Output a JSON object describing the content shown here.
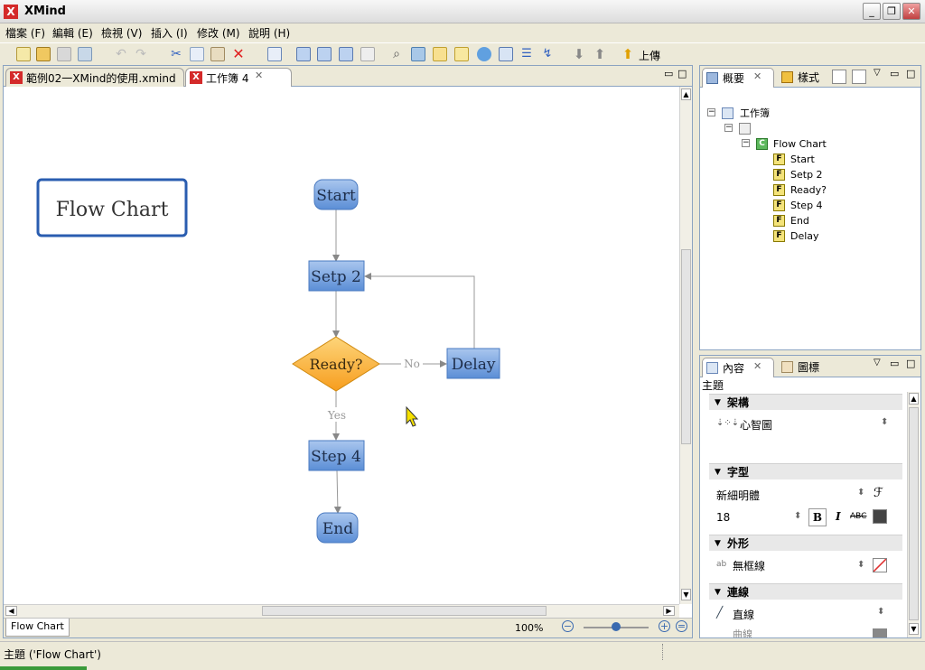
{
  "app": {
    "logo": "X",
    "title": "XMind"
  },
  "window_buttons": {
    "minimize": "_",
    "maximize": "❐",
    "close": "✕"
  },
  "menu": [
    "檔案 (F)",
    "編輯 (E)",
    "檢視 (V)",
    "插入 (I)",
    "修改 (M)",
    "說明 (H)"
  ],
  "toolbar": {
    "upload_label": "上傳"
  },
  "editor": {
    "tabs": [
      {
        "label": "範例02一XMind的使用.xmind",
        "active": false
      },
      {
        "label": "工作簿 4",
        "active": true
      }
    ],
    "bottom_tab": "Flow Chart",
    "zoom": "100%"
  },
  "diagram": {
    "floating_topic": "Flow Chart",
    "nodes": {
      "start": "Start",
      "step2": "Setp 2",
      "ready": "Ready?",
      "delay": "Delay",
      "step4": "Step 4",
      "end": "End"
    },
    "labels": {
      "no": "No",
      "yes": "Yes"
    }
  },
  "outline": {
    "tabs": [
      {
        "label": "概要"
      },
      {
        "label": "樣式"
      }
    ],
    "root": "工作簿",
    "central": "Flow Chart",
    "items": [
      "Start",
      "Setp 2",
      "Ready?",
      "Step 4",
      "End",
      "Delay"
    ]
  },
  "props": {
    "tabs": [
      {
        "label": "內容"
      },
      {
        "label": "圖標"
      }
    ],
    "header": "主題",
    "structure": {
      "title": "架構",
      "value": "心智圖"
    },
    "font": {
      "title": "字型",
      "family": "新細明體",
      "size": "18",
      "bold": "B",
      "italic": "I",
      "strike": "ABC",
      "f_icon": "ℱ"
    },
    "shape": {
      "title": "外形",
      "value": "無框線",
      "prefix": "ab"
    },
    "line": {
      "title": "連線",
      "value": "直線",
      "cut": "曲線"
    }
  },
  "status": {
    "text": "主題 ('Flow Chart')"
  },
  "colors": {
    "accent": "#2a5db0",
    "node": "#6a99d9",
    "diamond": "#fbb03b"
  }
}
